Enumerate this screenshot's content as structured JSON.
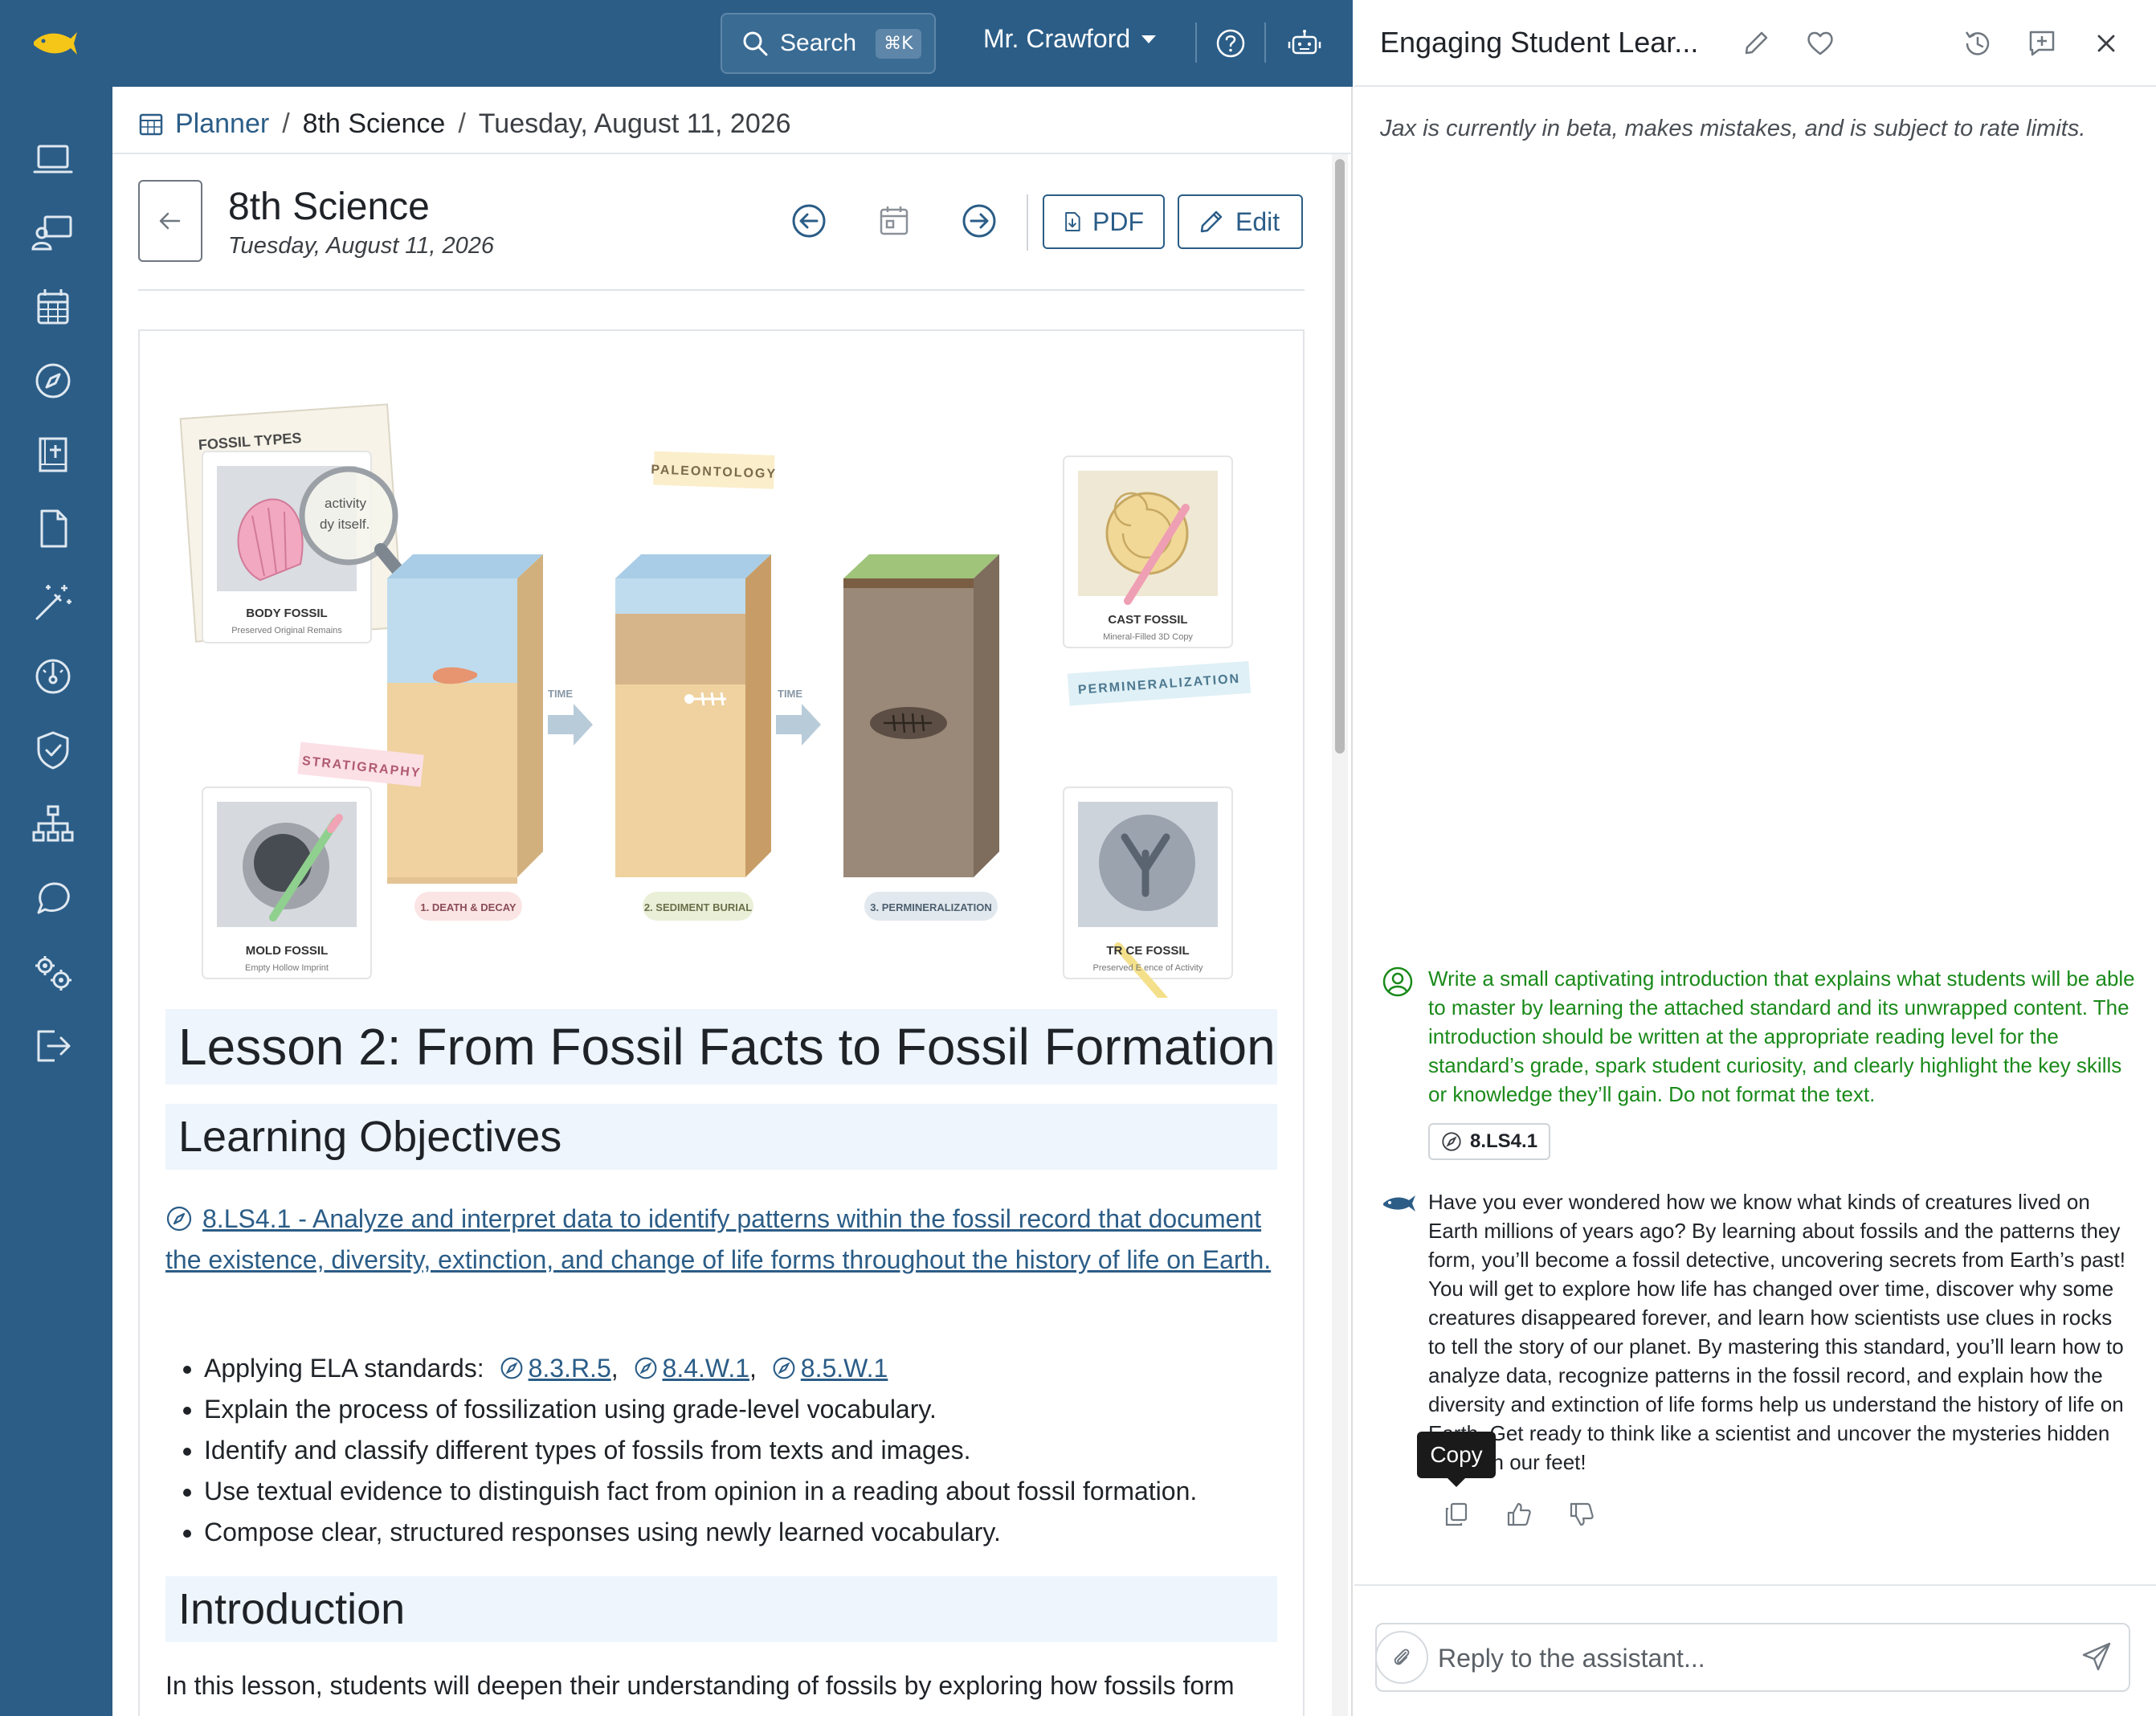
{
  "topbar": {
    "search_label": "Search",
    "search_shortcut": "⌘K",
    "user_name": "Mr. Crawford"
  },
  "sidebar": {
    "items": [
      {
        "icon": "laptop-icon"
      },
      {
        "icon": "teacher-icon"
      },
      {
        "icon": "calendar-grid-icon"
      },
      {
        "icon": "compass-icon"
      },
      {
        "icon": "book-icon"
      },
      {
        "icon": "document-icon"
      },
      {
        "icon": "magic-wand-icon"
      },
      {
        "icon": "gauge-icon"
      },
      {
        "icon": "shield-check-icon"
      },
      {
        "icon": "org-chart-icon"
      },
      {
        "icon": "chat-icon"
      },
      {
        "icon": "settings-icon"
      },
      {
        "icon": "logout-icon"
      }
    ]
  },
  "breadcrumb": {
    "root": "Planner",
    "course": "8th Science",
    "date": "Tuesday, August 11, 2026"
  },
  "header": {
    "title": "8th Science",
    "date": "Tuesday, August 11, 2026",
    "pdf_label": "PDF",
    "edit_label": "Edit"
  },
  "figure": {
    "fossil_types_label": "FOSSIL TYPES",
    "magnifier_text_1": "activity",
    "magnifier_text_2": "dy itself.",
    "paleontology_tag": "PALEONTOLOGY",
    "stratigraphy_tag": "STRATIGRAPHY",
    "permineralization_tag": "PERMINERALIZATION",
    "time_label": "TIME",
    "body_fossil": {
      "title": "BODY FOSSIL",
      "caption": "Preserved Original Remains"
    },
    "cast_fossil": {
      "title": "CAST FOSSIL",
      "caption": "Mineral-Filled 3D Copy"
    },
    "mold_fossil": {
      "title": "MOLD FOSSIL",
      "caption": "Empty Hollow Imprint"
    },
    "trace_fossil": {
      "title": "TR  CE FOSSIL",
      "caption": "Preserved E     ence of Activity"
    },
    "steps": [
      "1. DEATH & DECAY",
      "2. SEDIMENT BURIAL",
      "3. PERMINERALIZATION"
    ]
  },
  "lesson": {
    "title": "Lesson 2: From Fossil Facts to Fossil Formation",
    "objectives_heading": "Learning Objectives",
    "standard_link": "8.LS4.1 - Analyze and interpret data to identify patterns within the fossil record that document the existence, diversity, extinction, and change of life forms throughout the history of life on Earth.",
    "ela_prefix": "Applying ELA standards:",
    "ela_standards": [
      "8.3.R.5",
      "8.4.W.1",
      "8.5.W.1"
    ],
    "bullets": [
      "Explain the process of fossilization using grade-level vocabulary.",
      "Identify and classify different types of fossils from texts and images.",
      "Use textual evidence to distinguish fact from opinion in a reading about fossil formation.",
      "Compose clear, structured responses using newly learned vocabulary."
    ],
    "intro_heading": "Introduction",
    "intro_text": "In this lesson, students will deepen their understanding of fossils by exploring how fossils form"
  },
  "assistant": {
    "title": "Engaging Student Lear...",
    "beta_notice": "Jax is currently in beta, makes mistakes, and is subject to rate limits.",
    "user_message": "Write a small captivating introduction that explains what students will be able to master by learning the attached standard and its unwrapped content. The introduction should be written at the appropriate reading level for the standard’s grade, spark student curiosity, and clearly highlight the key skills or knowledge they’ll gain. Do not format the text.",
    "attached_standard": "8.LS4.1",
    "response": "Have you ever wondered how we know what kinds of creatures lived on Earth millions of years ago? By learning about fossils and the patterns they form, you’ll become a fossil detective, uncovering secrets from Earth’s past! You will get to explore how life has changed over time, discover why some creatures disappeared forever, and learn how scientists use clues in rocks to tell the story of our planet. By mastering this standard, you’ll learn how to analyze data, recognize patterns in the fossil record, and explain how the diversity and extinction of life forms help us understand the history of life on Earth. Get ready to think like a scientist and uncover the mysteries hidden beneath our feet!",
    "copy_tooltip": "Copy",
    "reply_placeholder": "Reply to the assistant..."
  },
  "colors": {
    "nav": "#2b5d87",
    "accent": "#2b5d87",
    "user_message": "#1a8a1a",
    "heading_bg": "#eef5fc"
  }
}
